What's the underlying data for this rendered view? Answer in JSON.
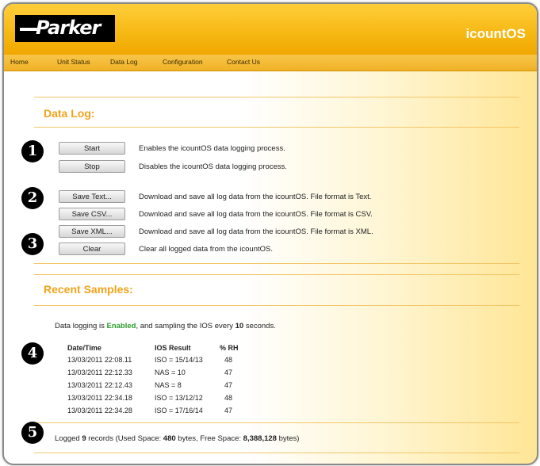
{
  "header": {
    "logo_text": "Parker",
    "app_title": "icountOS"
  },
  "nav": {
    "items": [
      "Home",
      "Unit Status",
      "Data Log",
      "Configuration",
      "Contact Us"
    ]
  },
  "data_log": {
    "title": "Data Log:",
    "actions": [
      {
        "label": "Start",
        "description": "Enables the icountOS data logging process."
      },
      {
        "label": "Stop",
        "description": "Disables the icountOS data logging process."
      },
      {
        "label": "Save Text...",
        "description": "Download and save all log data from the icountOS. File format is Text."
      },
      {
        "label": "Save CSV...",
        "description": "Download and save all log data from the icountOS. File format is CSV."
      },
      {
        "label": "Save XML...",
        "description": "Download and save all log data from the icountOS. File format is XML."
      },
      {
        "label": "Clear",
        "description": "Clear all logged data from the icountOS."
      }
    ]
  },
  "recent_samples": {
    "title": "Recent Samples:",
    "status_prefix": "Data logging is",
    "status_state": "Enabled",
    "status_mid": ", and sampling the IOS every",
    "status_interval": "10",
    "status_suffix": "seconds.",
    "columns": [
      "Date/Time",
      "IOS Result",
      "% RH"
    ],
    "rows": [
      [
        "13/03/2011 22:08.11",
        "ISO = 15/14/13",
        "48"
      ],
      [
        "13/03/2011 22:12.33",
        "NAS = 10",
        "47"
      ],
      [
        "13/03/2011 22:12.43",
        "NAS = 8",
        "47"
      ],
      [
        "13/03/2011 22:34.18",
        "ISO = 13/12/12",
        "48"
      ],
      [
        "13/03/2011 22:34.28",
        "ISO = 17/16/14",
        "47"
      ]
    ],
    "summary": {
      "prefix": "Logged",
      "count": "9",
      "mid1": "records (Used Space:",
      "used": "480",
      "mid2": "bytes, Free Space:",
      "free": "8,388,128",
      "suffix": "bytes)"
    }
  },
  "callouts": [
    "❶",
    "❷",
    "❸",
    "❹",
    "❺"
  ],
  "colors": {
    "accent": "#f2a31b",
    "header": "#f6b712",
    "enabled": "#2e9e2e"
  }
}
